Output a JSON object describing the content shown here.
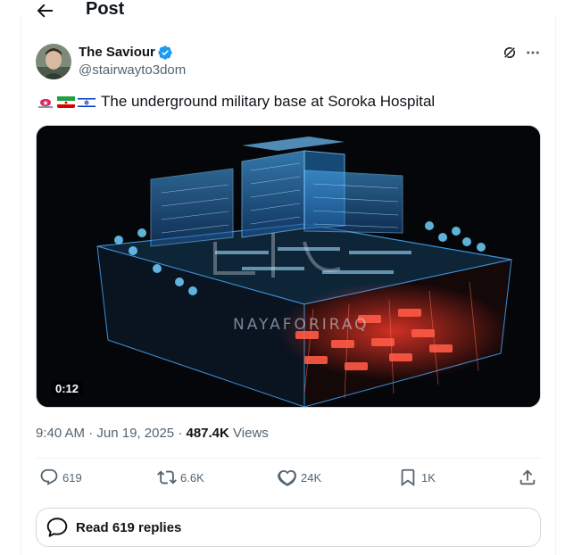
{
  "header": {
    "title": "Post"
  },
  "author": {
    "name": "The Saviour",
    "handle": "@stairwayto3dom"
  },
  "post": {
    "flags": [
      "alarm-icon",
      "iran-flag",
      "israel-flag"
    ],
    "text": "The underground military base at Soroka Hospital",
    "video": {
      "duration": "0:12",
      "watermark": "NAYAFORIRAQ"
    }
  },
  "meta": {
    "time": "9:40 AM",
    "separator": "·",
    "date": "Jun 19, 2025",
    "views_count": "487.4K",
    "views_label": "Views"
  },
  "actions": {
    "replies": "619",
    "reposts": "6.6K",
    "likes": "24K",
    "bookmarks": "1K"
  },
  "read_replies": {
    "label": "Read 619 replies"
  },
  "colors": {
    "verified": "#1d9bf0",
    "muted": "#536471",
    "text": "#0f1419",
    "border": "#cfd9de"
  }
}
